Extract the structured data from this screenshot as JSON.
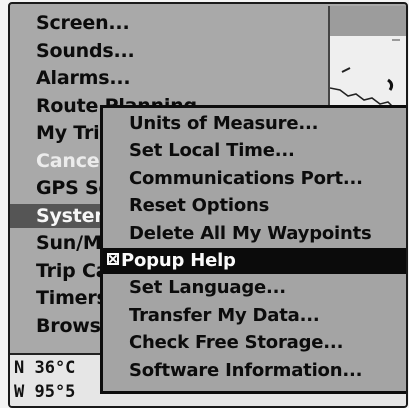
{
  "main_menu": {
    "items": [
      {
        "label": "Screen...",
        "state": "normal"
      },
      {
        "label": "Sounds...",
        "state": "normal"
      },
      {
        "label": "Alarms...",
        "state": "normal"
      },
      {
        "label": "Route Planning...",
        "state": "normal"
      },
      {
        "label": "My Trips...",
        "state": "normal"
      },
      {
        "label": "Cancel Navigation",
        "state": "disabled"
      },
      {
        "label": "GPS Setup...",
        "state": "normal"
      },
      {
        "label": "System Setup...",
        "state": "selected"
      },
      {
        "label": "Sun/Moon...",
        "state": "normal"
      },
      {
        "label": "Trip Calculator...",
        "state": "normal"
      },
      {
        "label": "Timers...",
        "state": "normal"
      },
      {
        "label": "Browse Files...",
        "state": "normal"
      }
    ]
  },
  "popup_menu": {
    "items": [
      {
        "label": "Units of Measure...",
        "highlight": false
      },
      {
        "label": "Set Local Time...",
        "highlight": false
      },
      {
        "label": "Communications Port...",
        "highlight": false
      },
      {
        "label": "Reset Options",
        "highlight": false
      },
      {
        "label": "Delete All My Waypoints",
        "highlight": false
      },
      {
        "label": "Popup Help",
        "highlight": true,
        "checked": true
      },
      {
        "label": "Set Language...",
        "highlight": false
      },
      {
        "label": "Transfer My Data...",
        "highlight": false
      },
      {
        "label": "Check Free Storage...",
        "highlight": false
      },
      {
        "label": "Software Information...",
        "highlight": false
      }
    ]
  },
  "coordinates": {
    "lat": "N  36°C",
    "lon": "W  95°5"
  }
}
